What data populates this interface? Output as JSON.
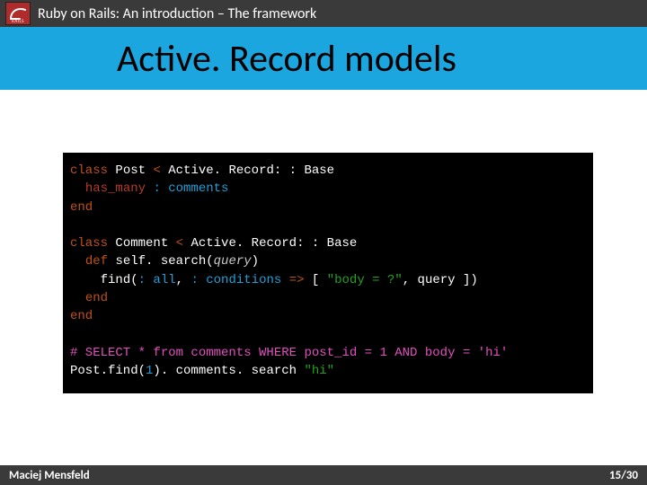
{
  "top": {
    "logo_label": "RAILS",
    "title": "Ruby on Rails: An introduction – The framework"
  },
  "slide": {
    "title": "Active. Record models"
  },
  "code": {
    "l1_class": "class",
    "l1_name": "Post",
    "l1_lt": "<",
    "l1_super": "Active. Record: : Base",
    "l2_macro": "has_many",
    "l2_sym": ": comments",
    "l3_end": "end",
    "l4_class": "class",
    "l4_name": "Comment",
    "l4_lt": "<",
    "l4_super": "Active. Record: : Base",
    "l5_def": "def",
    "l5_method": "self. search(",
    "l5_arg": "query",
    "l5_close": ")",
    "l6_find": "find(",
    "l6_sym1": ": all",
    "l6_comma1": ",",
    "l6_sym2": ": conditions",
    "l6_arrow": "=>",
    "l6_lbr": "[",
    "l6_str": "\"body = ?\"",
    "l6_comma2": ",",
    "l6_query": "query",
    "l6_rbr": "])",
    "l7_end": "end",
    "l8_end": "end",
    "l9_comment": "# SELECT * from comments WHERE post_id = 1 AND body = 'hi'",
    "l10_a": "Post.find(",
    "l10_num": "1",
    "l10_b": "). comments. search",
    "l10_str": "\"hi\""
  },
  "footer": {
    "author": "Maciej Mensfeld",
    "page": "15/30"
  }
}
